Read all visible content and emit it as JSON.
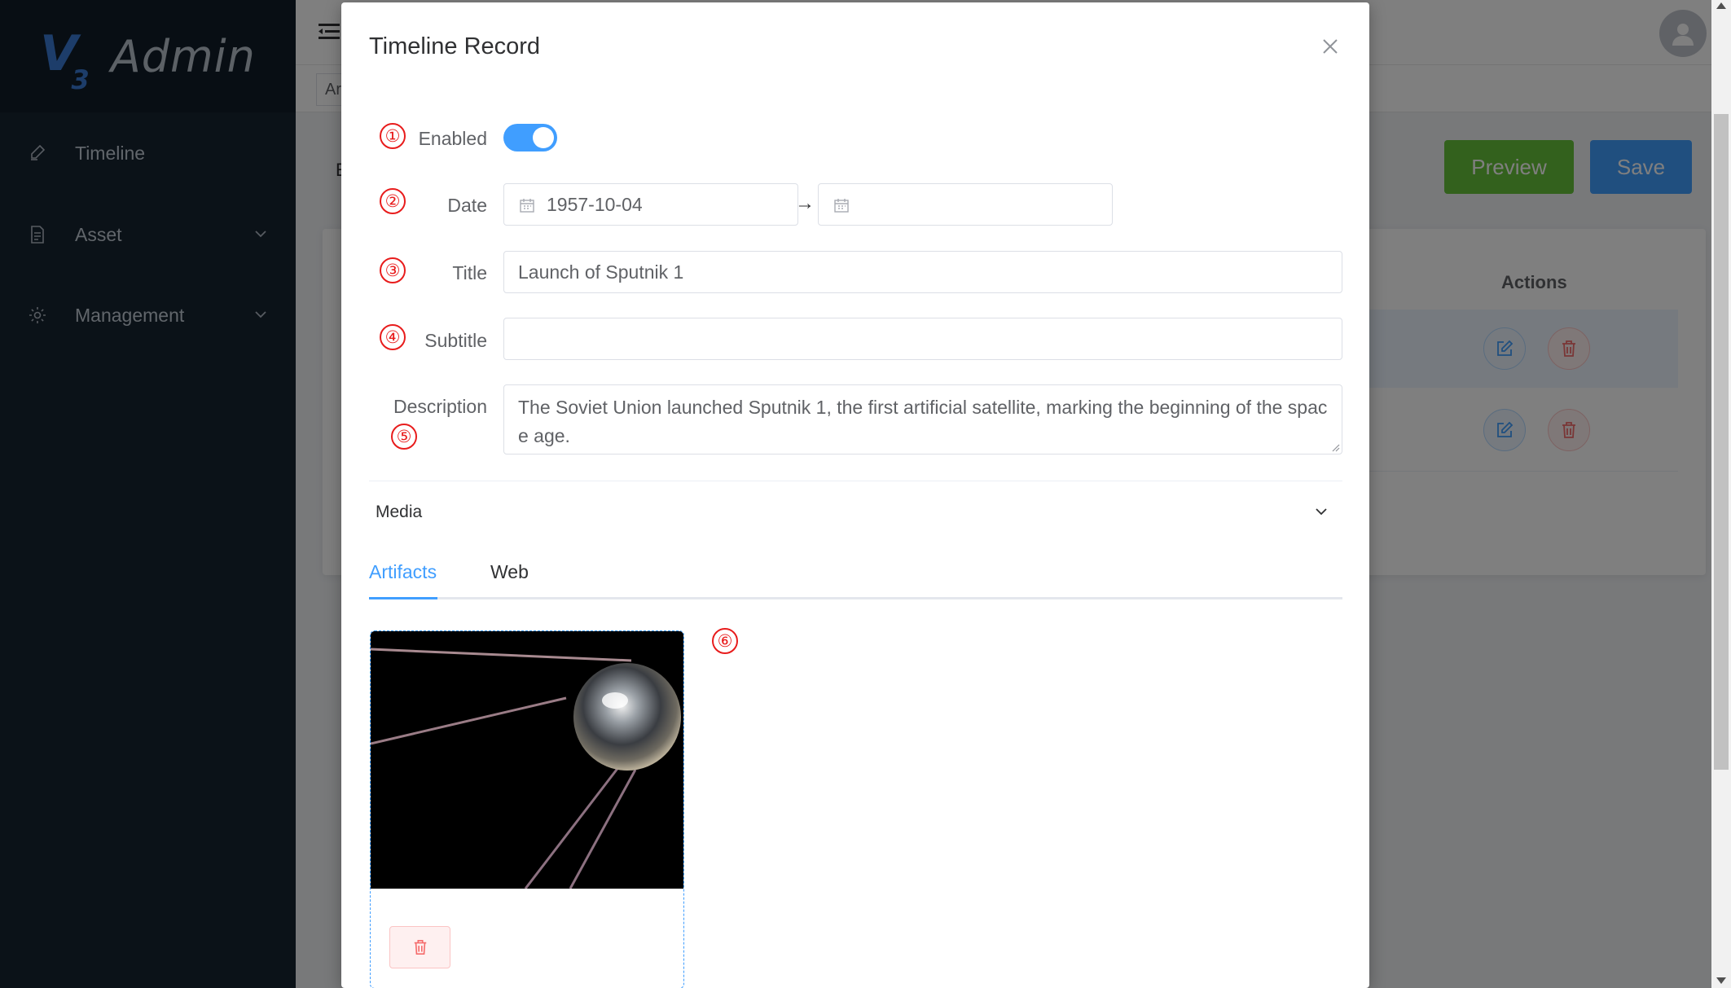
{
  "app": {
    "logo_mark": "V",
    "logo_sub": "3",
    "logo_text": "Admin"
  },
  "sidebar": {
    "items": [
      {
        "label": "Timeline",
        "icon": "pen-icon"
      },
      {
        "label": "Asset",
        "icon": "document-icon",
        "expandable": true
      },
      {
        "label": "Management",
        "icon": "gear-icon",
        "expandable": true
      }
    ]
  },
  "header": {
    "tag_stub": "Ar"
  },
  "page": {
    "title_stub": "E",
    "preview_label": "Preview",
    "save_label": "Save",
    "table": {
      "actions_header": "Actions"
    }
  },
  "dialog": {
    "title": "Timeline Record",
    "markers": [
      "①",
      "②",
      "③",
      "④",
      "⑤",
      "⑥"
    ],
    "enabled_label": "Enabled",
    "enabled_value": true,
    "date_label": "Date",
    "date_start": "1957-10-04",
    "date_end": "",
    "date_separator": "→",
    "title_label": "Title",
    "title_value": "Launch of Sputnik 1",
    "subtitle_label": "Subtitle",
    "subtitle_value": "",
    "description_label": "Description",
    "description_value": "The Soviet Union launched Sputnik 1, the first artificial satellite, marking the beginning of the space age.",
    "media_section": "Media",
    "tabs": [
      {
        "label": "Artifacts",
        "active": true
      },
      {
        "label": "Web",
        "active": false
      }
    ]
  },
  "colors": {
    "primary": "#409eff",
    "success": "#67c23a",
    "danger": "#f56c6c",
    "sidebar_bg": "#172431",
    "marker": "#e81c1c"
  }
}
